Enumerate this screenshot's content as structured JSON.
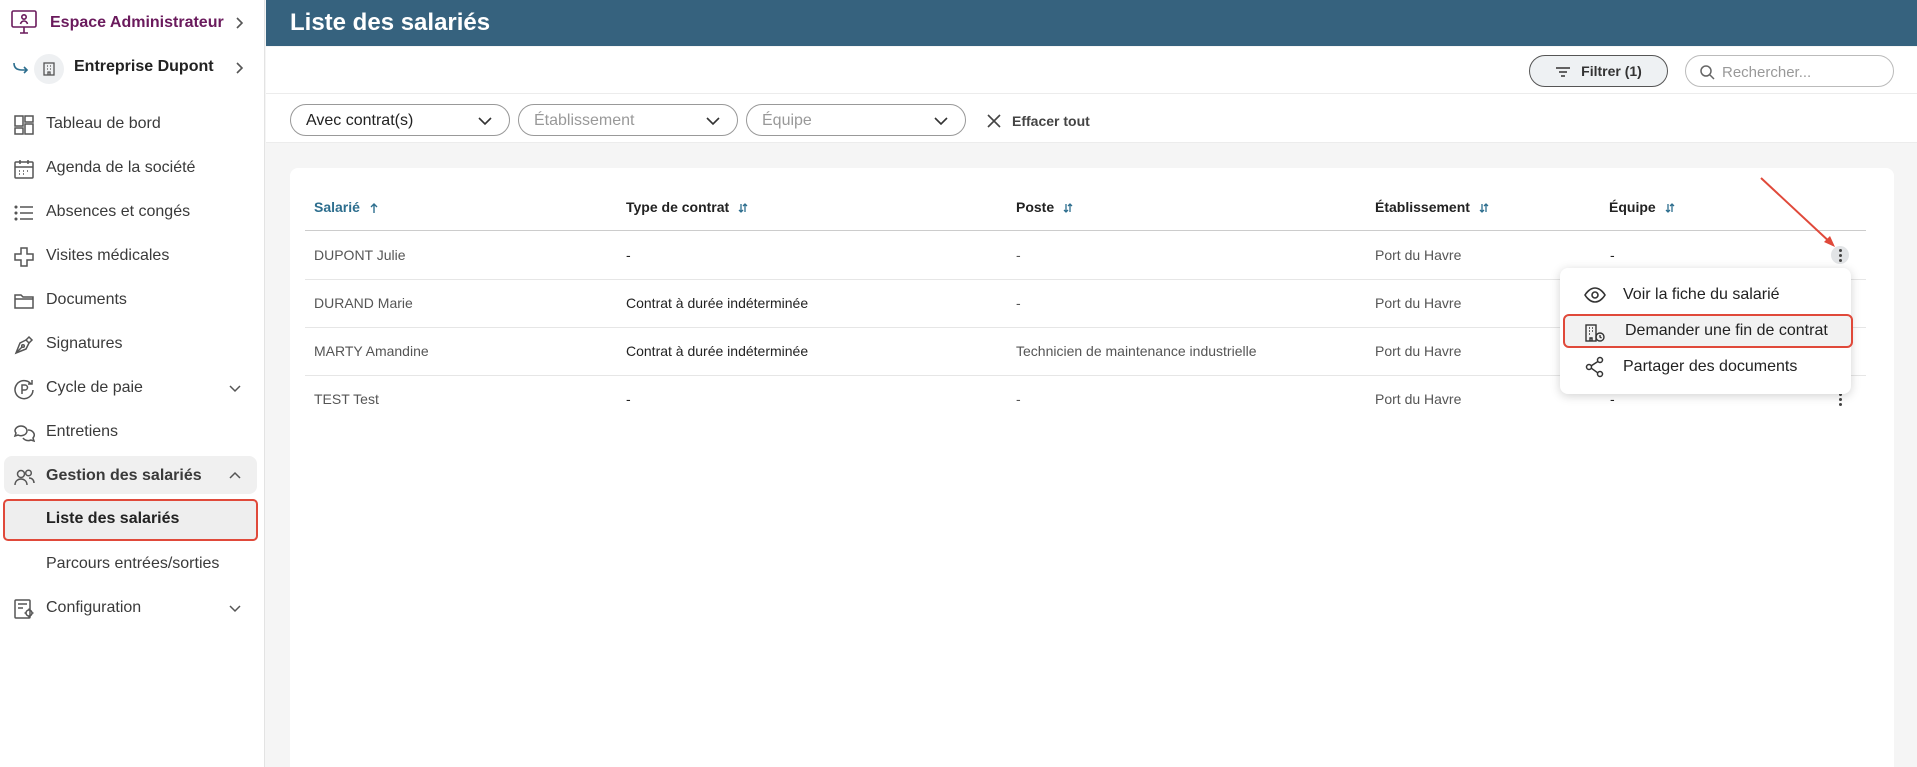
{
  "sidebar": {
    "admin_space": "Espace Administrateur",
    "company": "Entreprise Dupont",
    "items": [
      {
        "label": "Tableau de bord"
      },
      {
        "label": "Agenda de la société"
      },
      {
        "label": "Absences et congés"
      },
      {
        "label": "Visites médicales"
      },
      {
        "label": "Documents"
      },
      {
        "label": "Signatures"
      },
      {
        "label": "Cycle de paie"
      },
      {
        "label": "Entretiens"
      },
      {
        "label": "Gestion des salariés"
      },
      {
        "label": "Configuration"
      }
    ],
    "sub_items": [
      {
        "label": "Liste des salariés"
      },
      {
        "label": "Parcours entrées/sorties"
      }
    ]
  },
  "header": {
    "title": "Liste des salariés"
  },
  "toolbar": {
    "filter_label": "Filtrer (1)",
    "search_placeholder": "Rechercher..."
  },
  "filters": {
    "contract": "Avec contrat(s)",
    "establishment_placeholder": "Établissement",
    "team_placeholder": "Équipe",
    "clear_all": "Effacer tout"
  },
  "table": {
    "columns": [
      "Salarié",
      "Type de contrat",
      "Poste",
      "Établissement",
      "Équipe"
    ],
    "rows": [
      {
        "name": "DUPONT Julie",
        "contract": "-",
        "position": "-",
        "establishment": "Port du Havre",
        "team": "-"
      },
      {
        "name": "DURAND Marie",
        "contract": "Contrat à durée indéterminée",
        "position": "-",
        "establishment": "Port du Havre",
        "team": ""
      },
      {
        "name": "MARTY Amandine",
        "contract": "Contrat à durée indéterminée",
        "position": "Technicien de maintenance industrielle",
        "establishment": "Port du Havre",
        "team": ""
      },
      {
        "name": "TEST Test",
        "contract": "-",
        "position": "-",
        "establishment": "Port du Havre",
        "team": "-"
      }
    ]
  },
  "context_menu": {
    "items": [
      {
        "label": "Voir la fiche du salarié",
        "icon": "eye-icon"
      },
      {
        "label": "Demander une fin de contrat",
        "icon": "building-clock-icon"
      },
      {
        "label": "Partager des documents",
        "icon": "share-icon"
      }
    ]
  },
  "colors": {
    "header_bg": "#36627e",
    "accent": "#2d6e8e",
    "admin_purple": "#6a1a5c",
    "highlight_red": "#e0493a"
  }
}
